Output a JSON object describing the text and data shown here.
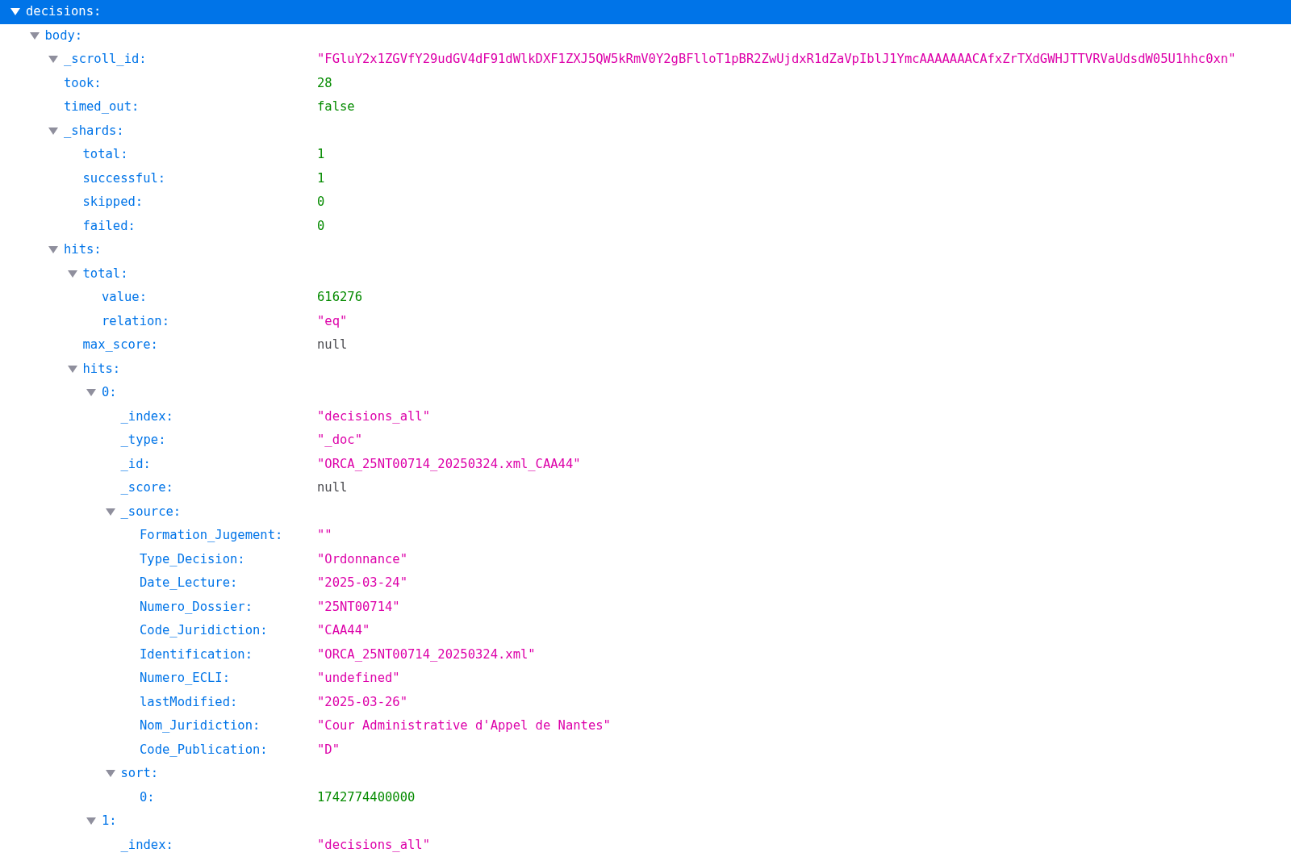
{
  "tree": [
    {
      "key": "decisions:",
      "selected": true,
      "expanded": true,
      "children": [
        {
          "key": "body:",
          "selected": false,
          "expanded": true,
          "children": [
            {
              "key": "_scroll_id:",
              "selected": false,
              "expanded": true,
              "kind": "string",
              "value": "\"FGluY2x1ZGVfY29udGV4dF91dWlkDXF1ZXJ5QW5kRmV0Y2gBFlloT1pBR2ZwUjdxR1dZaVpIblJ1YmcAAAAAAACAfxZrTXdGWHJTTVRVaUdsdW05U1hhc0xn\""
            },
            {
              "key": "took:",
              "selected": false,
              "kind": "number",
              "value": "28"
            },
            {
              "key": "timed_out:",
              "selected": false,
              "kind": "boolean",
              "value": "false"
            },
            {
              "key": "_shards:",
              "selected": false,
              "expanded": true,
              "children": [
                {
                  "key": "total:",
                  "selected": false,
                  "kind": "number",
                  "value": "1"
                },
                {
                  "key": "successful:",
                  "selected": false,
                  "kind": "number",
                  "value": "1"
                },
                {
                  "key": "skipped:",
                  "selected": false,
                  "kind": "number",
                  "value": "0"
                },
                {
                  "key": "failed:",
                  "selected": false,
                  "kind": "number",
                  "value": "0"
                }
              ]
            },
            {
              "key": "hits:",
              "selected": false,
              "expanded": true,
              "children": [
                {
                  "key": "total:",
                  "selected": false,
                  "expanded": true,
                  "children": [
                    {
                      "key": "value:",
                      "selected": false,
                      "kind": "number",
                      "value": "616276"
                    },
                    {
                      "key": "relation:",
                      "selected": false,
                      "kind": "string",
                      "value": "\"eq\""
                    }
                  ]
                },
                {
                  "key": "max_score:",
                  "selected": false,
                  "kind": "null",
                  "value": "null"
                },
                {
                  "key": "hits:",
                  "selected": false,
                  "expanded": true,
                  "children": [
                    {
                      "key": "0:",
                      "selected": false,
                      "expanded": true,
                      "children": [
                        {
                          "key": "_index:",
                          "selected": false,
                          "kind": "string",
                          "value": "\"decisions_all\""
                        },
                        {
                          "key": "_type:",
                          "selected": false,
                          "kind": "string",
                          "value": "\"_doc\""
                        },
                        {
                          "key": "_id:",
                          "selected": false,
                          "kind": "string",
                          "value": "\"ORCA_25NT00714_20250324.xml_CAA44\""
                        },
                        {
                          "key": "_score:",
                          "selected": false,
                          "kind": "null",
                          "value": "null"
                        },
                        {
                          "key": "_source:",
                          "selected": false,
                          "expanded": true,
                          "children": [
                            {
                              "key": "Formation_Jugement:",
                              "selected": false,
                              "kind": "string",
                              "value": "\"\""
                            },
                            {
                              "key": "Type_Decision:",
                              "selected": false,
                              "kind": "string",
                              "value": "\"Ordonnance\""
                            },
                            {
                              "key": "Date_Lecture:",
                              "selected": false,
                              "kind": "string",
                              "value": "\"2025-03-24\""
                            },
                            {
                              "key": "Numero_Dossier:",
                              "selected": false,
                              "kind": "string",
                              "value": "\"25NT00714\""
                            },
                            {
                              "key": "Code_Juridiction:",
                              "selected": false,
                              "kind": "string",
                              "value": "\"CAA44\""
                            },
                            {
                              "key": "Identification:",
                              "selected": false,
                              "kind": "string",
                              "value": "\"ORCA_25NT00714_20250324.xml\""
                            },
                            {
                              "key": "Numero_ECLI:",
                              "selected": false,
                              "kind": "string",
                              "value": "\"undefined\""
                            },
                            {
                              "key": "lastModified:",
                              "selected": false,
                              "kind": "string",
                              "value": "\"2025-03-26\""
                            },
                            {
                              "key": "Nom_Juridiction:",
                              "selected": false,
                              "kind": "string",
                              "value": "\"Cour Administrative d'Appel de Nantes\""
                            },
                            {
                              "key": "Code_Publication:",
                              "selected": false,
                              "kind": "string",
                              "value": "\"D\""
                            }
                          ]
                        },
                        {
                          "key": "sort:",
                          "selected": false,
                          "expanded": true,
                          "children": [
                            {
                              "key": "0:",
                              "selected": false,
                              "kind": "number",
                              "value": "1742774400000"
                            }
                          ]
                        }
                      ]
                    },
                    {
                      "key": "1:",
                      "selected": false,
                      "expanded": true,
                      "children": [
                        {
                          "key": "_index:",
                          "selected": false,
                          "kind": "string",
                          "value": "\"decisions_all\""
                        }
                      ]
                    }
                  ]
                }
              ]
            }
          ]
        }
      ]
    }
  ]
}
